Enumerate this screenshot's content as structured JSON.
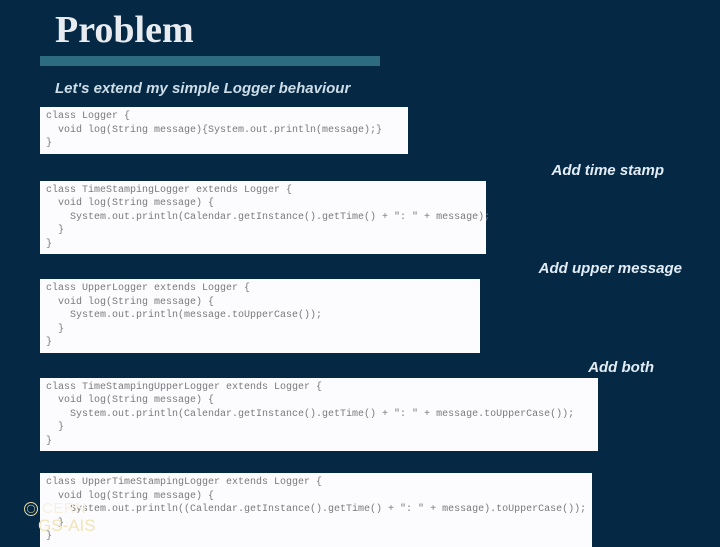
{
  "title": "Problem",
  "intro": "Let's extend my simple Logger behaviour",
  "annotations": {
    "time_stamp": "Add time stamp",
    "upper_msg": "Add upper message",
    "both": "Add both"
  },
  "code": {
    "block1": {
      "l1": "class Logger {",
      "l2": "  void log(String message){System.out.println(message);}",
      "l3": "}"
    },
    "block2": {
      "l1": "class TimeStampingLogger extends Logger {",
      "l2": "  void log(String message) {",
      "l3": "    System.out.println(Calendar.getInstance().getTime() + \": \" + message);",
      "l4": "  }",
      "l5": "}"
    },
    "block3": {
      "l1": "class UpperLogger extends Logger {",
      "l2": "  void log(String message) {",
      "l3": "    System.out.println(message.toUpperCase());",
      "l4": "  }",
      "l5": "}"
    },
    "block4": {
      "l1": "class TimeStampingUpperLogger extends Logger {",
      "l2": "  void log(String message) {",
      "l3": "    System.out.println(Calendar.getInstance().getTime() + \": \" + message.toUpperCase());",
      "l4": "  }",
      "l5": "}"
    },
    "block5": {
      "l1": "class UpperTimeStampingLogger extends Logger {",
      "l2": "  void log(String message) {",
      "l3": "    System.out.println((Calendar.getInstance().getTime() + \": \" + message).toUpperCase());",
      "l4": "  }",
      "l5": "}"
    }
  },
  "footer": {
    "cern": "CERN",
    "gs": "GS-AIS"
  }
}
